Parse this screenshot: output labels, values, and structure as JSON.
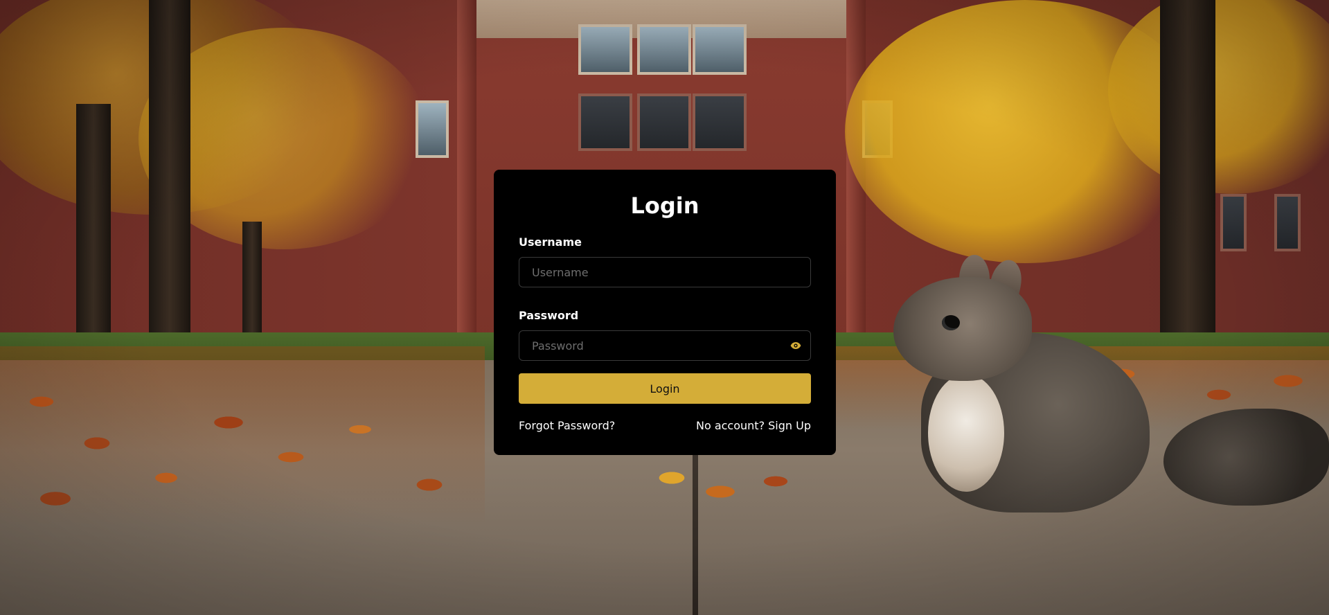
{
  "login_card": {
    "title": "Login",
    "username": {
      "label": "Username",
      "placeholder": "Username",
      "value": ""
    },
    "password": {
      "label": "Password",
      "placeholder": "Password",
      "value": "",
      "toggle_icon": "eye-icon"
    },
    "submit_label": "Login",
    "forgot_password_label": "Forgot Password?",
    "signup_label": "No account? Sign Up"
  },
  "theme": {
    "card_background": "#000000",
    "accent": "#d4ad38",
    "text": "#ffffff",
    "placeholder": "#6e6e6e"
  },
  "background": {
    "description_icon": "campus-autumn-squirrel-photo"
  }
}
